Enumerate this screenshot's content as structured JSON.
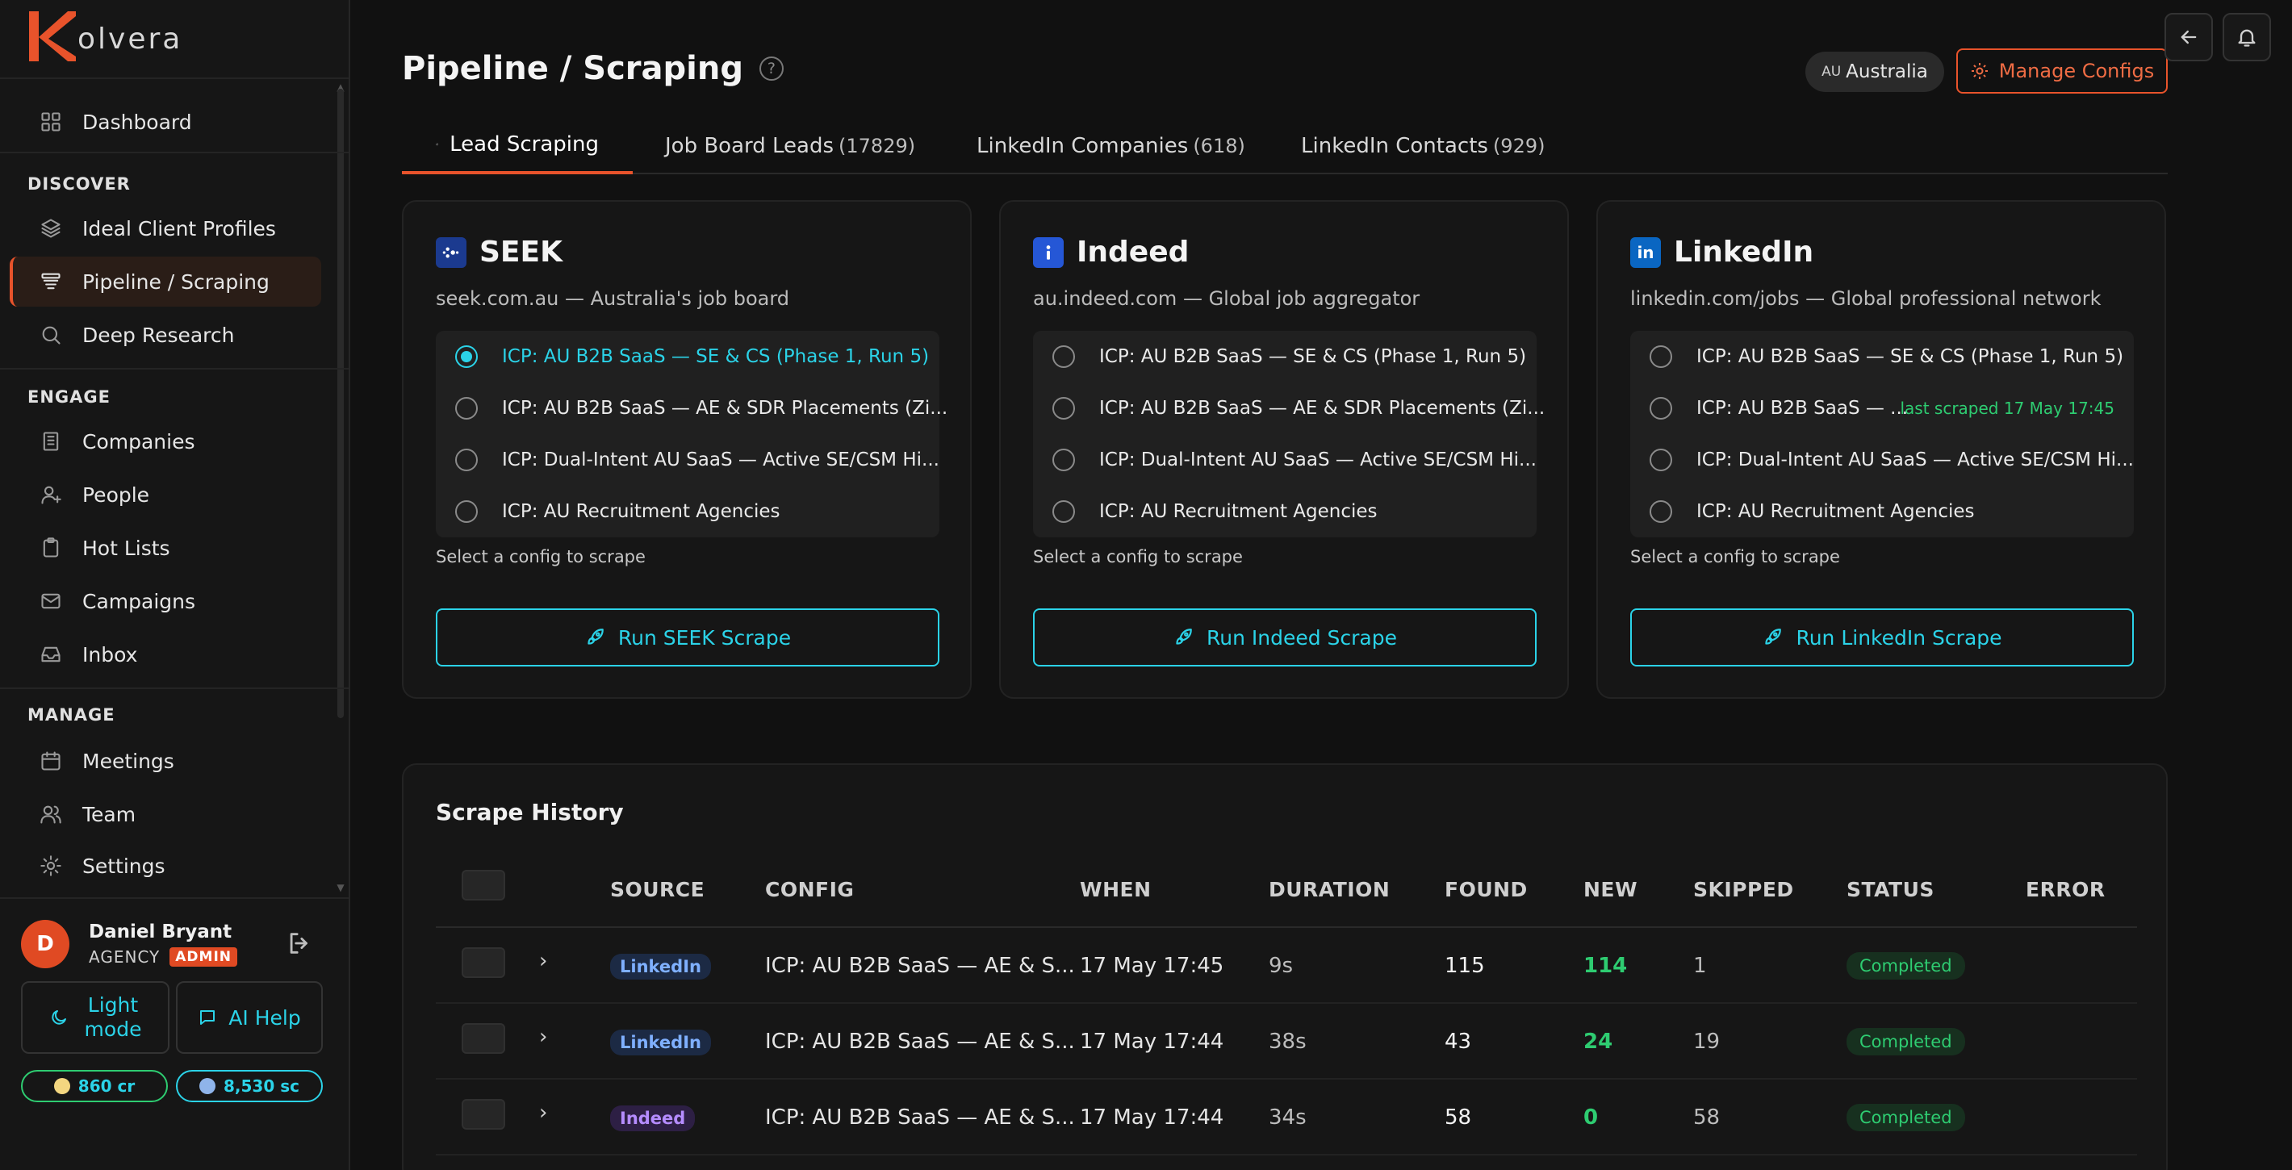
{
  "app": {
    "brand": "olvera"
  },
  "sidebar": {
    "dashboard": "Dashboard",
    "sections": {
      "discover": "DISCOVER",
      "engage": "ENGAGE",
      "manage": "MANAGE"
    },
    "discover_items": [
      "Ideal Client Profiles",
      "Pipeline / Scraping",
      "Deep Research"
    ],
    "engage_items": [
      "Companies",
      "People",
      "Hot Lists",
      "Campaigns",
      "Inbox"
    ],
    "manage_items": [
      "Meetings",
      "Team",
      "Settings"
    ],
    "active_item": "Pipeline / Scraping",
    "user": {
      "initial": "D",
      "name": "Daniel Bryant",
      "role": "AGENCY",
      "badge": "ADMIN"
    },
    "mode_button": {
      "line1": "Light",
      "line2": "mode"
    },
    "help_button": "AI Help",
    "credits": {
      "cr": "860 cr",
      "sc": "8,530 sc"
    }
  },
  "header": {
    "title": "Pipeline / Scraping",
    "help_glyph": "?",
    "country_code": "AU",
    "country": "Australia",
    "manage_configs": "Manage Configs"
  },
  "tabs": [
    {
      "label": "Lead Scraping",
      "count": ""
    },
    {
      "label": "Job Board Leads",
      "count": "(17829)"
    },
    {
      "label": "LinkedIn Companies",
      "count": "(618)"
    },
    {
      "label": "LinkedIn Contacts",
      "count": "(929)"
    }
  ],
  "sources": [
    {
      "name": "SEEK",
      "subtitle": "seek.com.au — Australia's job board",
      "configs": [
        "ICP: AU B2B SaaS — SE & CS (Phase 1, Run 5)",
        "ICP: AU B2B SaaS — AE & SDR Placements (Zi...",
        "ICP: Dual-Intent AU SaaS — Active SE/CSM Hi...",
        "ICP: AU Recruitment Agencies"
      ],
      "selected_index": 0,
      "hint": "Select a config to scrape",
      "button": "Run SEEK Scrape",
      "color": "#1b3a8f"
    },
    {
      "name": "Indeed",
      "subtitle": "au.indeed.com — Global job aggregator",
      "configs": [
        "ICP: AU B2B SaaS — SE & CS (Phase 1, Run 5)",
        "ICP: AU B2B SaaS — AE & SDR Placements (Zi...",
        "ICP: Dual-Intent AU SaaS — Active SE/CSM Hi...",
        "ICP: AU Recruitment Agencies"
      ],
      "selected_index": -1,
      "hint": "Select a config to scrape",
      "button": "Run Indeed Scrape",
      "color": "#2557d6"
    },
    {
      "name": "LinkedIn",
      "subtitle": "linkedin.com/jobs — Global professional network",
      "configs": [
        "ICP: AU B2B SaaS — SE & CS (Phase 1, Run 5)",
        "ICP: AU B2B SaaS — ...",
        "ICP: Dual-Intent AU SaaS — Active SE/CSM Hi...",
        "ICP: AU Recruitment Agencies"
      ],
      "last_scraped": "last scraped 17 May 17:45",
      "selected_index": -1,
      "hint": "Select a config to scrape",
      "button": "Run LinkedIn Scrape",
      "color": "#0a66c2"
    }
  ],
  "history": {
    "title": "Scrape History",
    "columns": [
      "SOURCE",
      "CONFIG",
      "WHEN",
      "DURATION",
      "FOUND",
      "NEW",
      "SKIPPED",
      "STATUS",
      "ERROR"
    ],
    "rows": [
      {
        "source": "LinkedIn",
        "config": "ICP: AU B2B SaaS — AE & S...",
        "when": "17 May 17:45",
        "duration": "9s",
        "found": "115",
        "new": "114",
        "skipped": "1",
        "status": "Completed",
        "error": ""
      },
      {
        "source": "LinkedIn",
        "config": "ICP: AU B2B SaaS — AE & S...",
        "when": "17 May 17:44",
        "duration": "38s",
        "found": "43",
        "new": "24",
        "skipped": "19",
        "status": "Completed",
        "error": ""
      },
      {
        "source": "Indeed",
        "config": "ICP: AU B2B SaaS — AE & S...",
        "when": "17 May 17:44",
        "duration": "34s",
        "found": "58",
        "new": "0",
        "skipped": "58",
        "status": "Completed",
        "error": ""
      }
    ]
  },
  "colors": {
    "accent": "#e8532b",
    "cyan": "#2bd3e8",
    "green": "#2ecc71"
  }
}
